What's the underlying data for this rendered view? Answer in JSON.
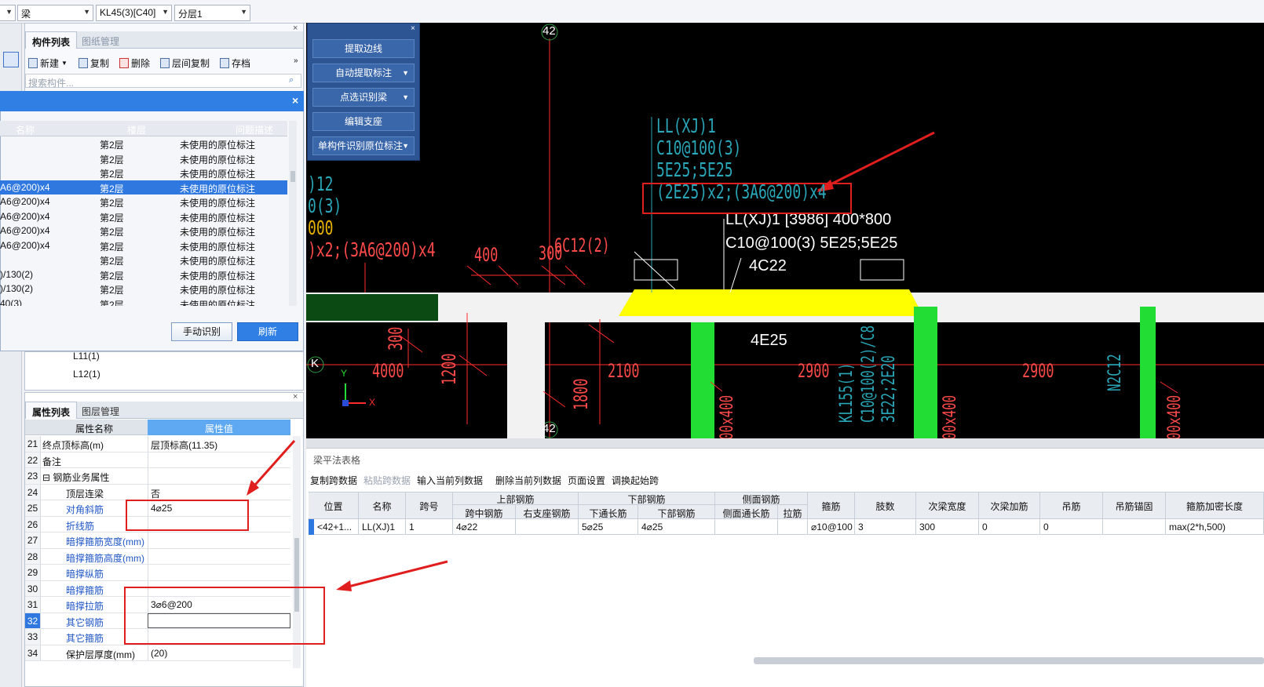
{
  "toolbar": {
    "combo_type": "梁",
    "combo_member": "KL45(3)[C40]",
    "combo_layer": "分层1"
  },
  "component_panel": {
    "tab_list": "构件列表",
    "tab_drawings": "图纸管理",
    "btn_new": "新建",
    "btn_copy": "复制",
    "btn_delete": "删除",
    "btn_floor_copy": "层间复制",
    "btn_save": "存档",
    "search_placeholder": "搜索构件..."
  },
  "issue_dialog": {
    "col_name": "名称",
    "col_floor": "楼层",
    "col_desc": "问题描述",
    "rows": [
      {
        "name": "",
        "floor": "第2层",
        "desc": "未使用的原位标注"
      },
      {
        "name": "",
        "floor": "第2层",
        "desc": "未使用的原位标注"
      },
      {
        "name": "",
        "floor": "第2层",
        "desc": "未使用的原位标注"
      },
      {
        "name": "A6@200)x4",
        "floor": "第2层",
        "desc": "未使用的原位标注"
      },
      {
        "name": "A6@200)x4",
        "floor": "第2层",
        "desc": "未使用的原位标注"
      },
      {
        "name": "A6@200)x4",
        "floor": "第2层",
        "desc": "未使用的原位标注"
      },
      {
        "name": "A6@200)x4",
        "floor": "第2层",
        "desc": "未使用的原位标注"
      },
      {
        "name": "A6@200)x4",
        "floor": "第2层",
        "desc": "未使用的原位标注"
      },
      {
        "name": "",
        "floor": "第2层",
        "desc": "未使用的原位标注"
      },
      {
        "name": ")/130(2)",
        "floor": "第2层",
        "desc": "未使用的原位标注"
      },
      {
        "name": ")/130(2)",
        "floor": "第2层",
        "desc": "未使用的原位标注"
      },
      {
        "name": "40(3)",
        "floor": "第2层",
        "desc": "未使用的原位标注"
      }
    ],
    "btn_manual": "手动识别",
    "btn_refresh": "刷新"
  },
  "tree": {
    "items": [
      "L11(1)",
      "L12(1)"
    ]
  },
  "props_panel": {
    "tab_props": "属性列表",
    "tab_layers": "图层管理",
    "col_name": "属性名称",
    "col_value": "属性值",
    "rows": [
      {
        "num": "21",
        "name": "终点顶标高(m)",
        "value": "层顶标高(11.35)",
        "blue": false
      },
      {
        "num": "22",
        "name": "备注",
        "value": "",
        "blue": false
      },
      {
        "num": "23",
        "name": "⊟ 钢筋业务属性",
        "value": "",
        "blue": false
      },
      {
        "num": "24",
        "name": "顶层连梁",
        "value": "否",
        "blue": false,
        "indent": true
      },
      {
        "num": "25",
        "name": "对角斜筋",
        "value": "4⌀25",
        "blue": true
      },
      {
        "num": "26",
        "name": "折线筋",
        "value": "",
        "blue": true
      },
      {
        "num": "27",
        "name": "暗撑箍筋宽度(mm)",
        "value": "",
        "blue": true
      },
      {
        "num": "28",
        "name": "暗撑箍筋高度(mm)",
        "value": "",
        "blue": true
      },
      {
        "num": "29",
        "name": "暗撑纵筋",
        "value": "",
        "blue": true
      },
      {
        "num": "30",
        "name": "暗撑箍筋",
        "value": "",
        "blue": true
      },
      {
        "num": "31",
        "name": "暗撑拉筋",
        "value": "3⌀6@200",
        "blue": true
      },
      {
        "num": "32",
        "name": "其它钢筋",
        "value": "",
        "blue": true
      },
      {
        "num": "33",
        "name": "其它箍筋",
        "value": "",
        "blue": true
      },
      {
        "num": "34",
        "name": "保护层厚度(mm)",
        "value": "(20)",
        "blue": false,
        "indent": true
      }
    ]
  },
  "cad_panel": {
    "btn1": "提取边线",
    "btn2": "自动提取标注",
    "btn3": "点选识别梁",
    "btn4": "编辑支座",
    "btn5": "单构件识别原位标注"
  },
  "cad": {
    "axis_top": "42",
    "axis_bottom": "42",
    "axis_k": "K",
    "ann_cyan_1": "LL(XJ)1",
    "ann_cyan_2": "C10@100(3)",
    "ann_cyan_3": "5E25;5E25",
    "ann_cyan_4": "(2E25)x2;(3A6@200)x4",
    "ann_white_1": "LL(XJ)1 [3986] 400*800",
    "ann_white_2": "C10@100(3) 5E25;5E25",
    "ann_white_3": "4C22",
    "ann_white_4": "4E25",
    "ann_left_1": ")12",
    "ann_left_2": "0(3)",
    "ann_left_3": "000",
    "ann_left_4": ")x2;(3A6@200)x4",
    "dim_400": "400",
    "dim_300a": "300",
    "dim_6c12": "6C12(2)",
    "dim_300b": "300",
    "dim_4000": "4000",
    "dim_1200": "1200",
    "dim_2100": "2100",
    "dim_1800": "1800",
    "dim_2900a": "2900",
    "dim_2900b": "2900",
    "v_kl": "KL155(1)",
    "v_c10": "C10@100(2)/C8",
    "v_e22": "3E22;2E20",
    "v_n": "N2C12",
    "v_400a": "00x400",
    "v_400b": "00x400",
    "v_400c": "00x400",
    "ucs_y": "Y",
    "ucs_x": "X"
  },
  "table": {
    "title": "梁平法表格",
    "tools": [
      "复制跨数据",
      "粘贴跨数据",
      "输入当前列数据",
      "删除当前列数据",
      "页面设置",
      "调换起始跨"
    ],
    "headers": {
      "pos": "位置",
      "name": "名称",
      "span": "跨号",
      "top": "上部钢筋",
      "top_mid": "跨中钢筋",
      "top_right": "右支座钢筋",
      "bot": "下部钢筋",
      "bot_through": "下通长筋",
      "bot_bar": "下部钢筋",
      "side": "侧面钢筋",
      "side_through": "侧面通长筋",
      "side_tie": "拉筋",
      "stirrup": "箍筋",
      "legs": "肢数",
      "sec_width": "次梁宽度",
      "sec_add": "次梁加筋",
      "hanger": "吊筋",
      "hanger_anchor": "吊筋锚固",
      "stir_len": "箍筋加密长度"
    },
    "row": {
      "pos": "<42+1...",
      "name": "LL(XJ)1",
      "span": "1",
      "top_mid": "4⌀22",
      "top_right": "",
      "bot_through": "5⌀25",
      "bot_bar": "4⌀25",
      "side_through": "",
      "side_tie": "",
      "stirrup": "⌀10@100",
      "legs": "3",
      "sec_width": "300",
      "sec_add": "0",
      "hanger": "0",
      "hanger_anchor": "",
      "stir_len": "max(2*h,500)"
    }
  },
  "colors": {
    "accent": "#2f78e0",
    "cad_bg": "#000000",
    "annotation_red": "#e01e1e",
    "beam_yellow": "#ffff00",
    "column_green": "#22dd33"
  }
}
